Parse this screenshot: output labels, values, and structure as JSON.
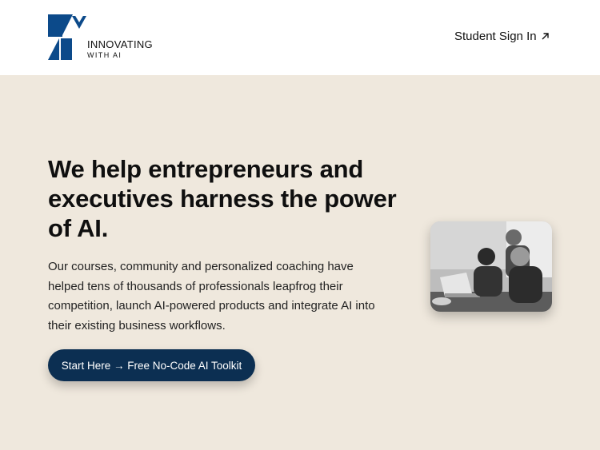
{
  "header": {
    "logo": {
      "line1": "INNOVATING",
      "line2": "WITH AI",
      "color": "#0c4a8a"
    },
    "signin_label": "Student Sign In",
    "signin_icon": "arrow-up-right-icon"
  },
  "hero": {
    "background": "#efe8dd",
    "headline": "We help entrepreneurs and executives harness the power of AI.",
    "body": "Our courses, community and personalized coaching have helped tens of thousands of professionals leapfrog their competition, launch AI-powered products and integrate AI into their existing business workflows.",
    "cta_label": "Start Here → Free No-Code AI Toolkit",
    "cta_color": "#0c2f52"
  }
}
